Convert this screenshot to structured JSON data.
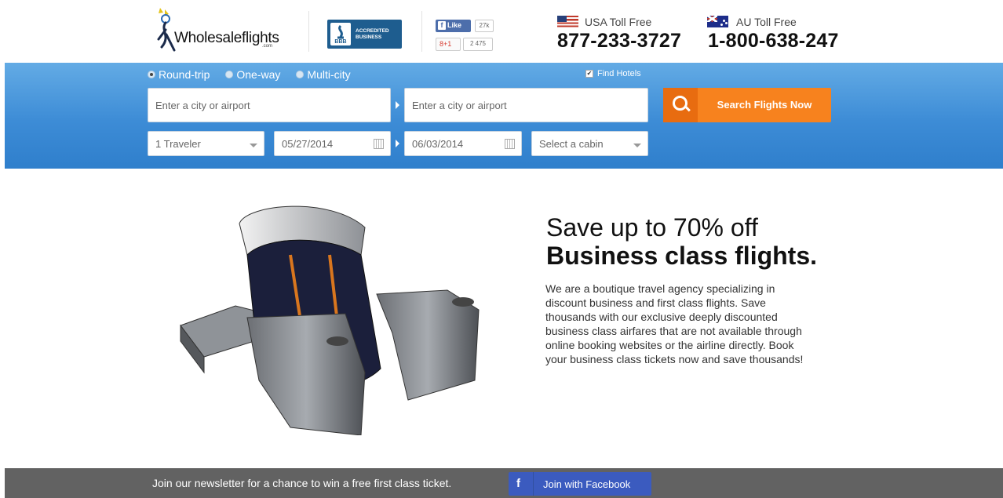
{
  "header": {
    "logo_text": "Wholesaleflights",
    "logo_sub": ".com",
    "bbb_text_line1": "ACCREDITED",
    "bbb_text_line2": "BUSINESS",
    "bbb_mark": "BBB",
    "fb_like_label": "Like",
    "fb_like_count": "27k",
    "gplus_label": "8+1",
    "gplus_count": "2 475",
    "usa_label": "USA Toll Free",
    "usa_number": "877-233-3727",
    "au_label": "AU Toll Free",
    "au_number": "1-800-638-247"
  },
  "search": {
    "trip_types": [
      "Round-trip",
      "One-way",
      "Multi-city"
    ],
    "selected_trip": "Round-trip",
    "find_hotels_label": "Find Hotels",
    "find_hotels_checked": true,
    "from_placeholder": "Enter a city or airport",
    "to_placeholder": "Enter a city or airport",
    "travelers": "1 Traveler",
    "depart_date": "05/27/2014",
    "return_date": "06/03/2014",
    "cabin": "Select a cabin",
    "button_label": "Search Flights Now",
    "button_color": "#f7821e"
  },
  "hero": {
    "title_line1": "Save up to 70% off",
    "title_line2": "Business class flights.",
    "description": "We are a boutique travel agency specializing in discount business and first class flights. Save thousands with our exclusive deeply discounted business class airfares that are not available through online booking websites or the airline directly. Book your business class tickets now and save thousands!"
  },
  "footer": {
    "newsletter_text": "Join our newsletter for a chance to win a free first class ticket.",
    "facebook_button_label": "Join with Facebook",
    "facebook_icon": "f"
  }
}
